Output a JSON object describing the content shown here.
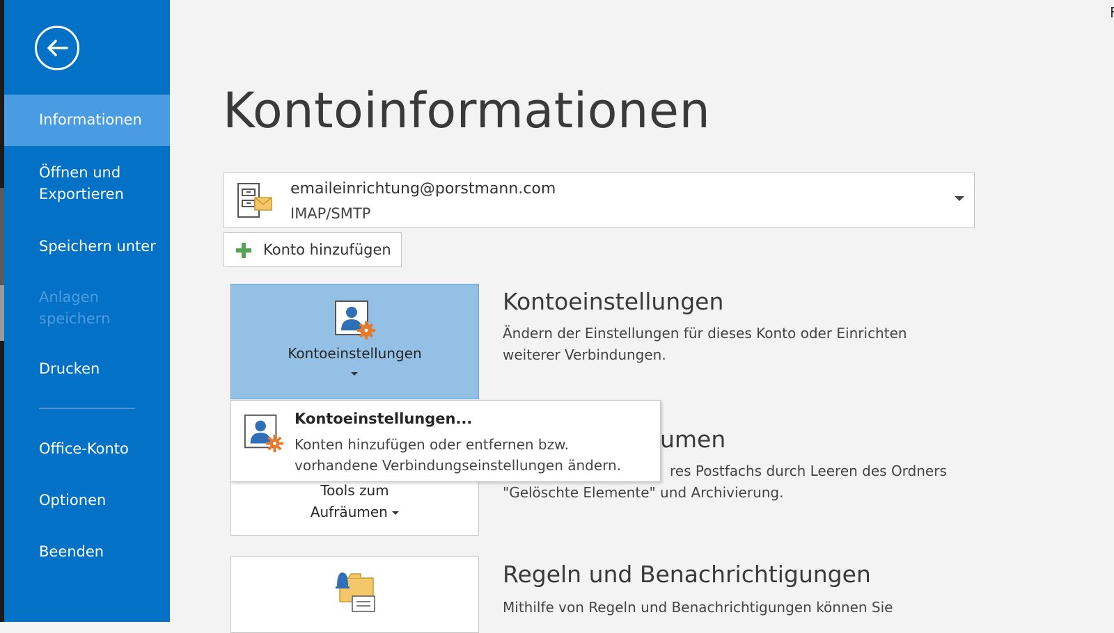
{
  "sidebar": {
    "items": [
      {
        "label": "Informationen"
      },
      {
        "label_line1": "Öffnen und",
        "label_line2": "Exportieren"
      },
      {
        "label": "Speichern unter"
      },
      {
        "label_line1": "Anlagen",
        "label_line2": "speichern"
      },
      {
        "label": "Drucken"
      },
      {
        "label": "Office-Konto"
      },
      {
        "label": "Optionen"
      },
      {
        "label": "Beenden"
      }
    ]
  },
  "main": {
    "title": "Kontoinformationen",
    "account": {
      "email": "emaileinrichtung@porstmann.com",
      "type": "IMAP/SMTP"
    },
    "add_account_label": "Konto hinzufügen",
    "sections": [
      {
        "tile_label": "Kontoeinstellungen",
        "title": "Kontoeinstellungen",
        "desc_line1": "Ändern der Einstellungen für dieses Konto oder Einrichten",
        "desc_line2": "weiterer Verbindungen."
      },
      {
        "tile_label_line1": "Tools zum",
        "tile_label_line2": "Aufräumen",
        "title_visible": "umen",
        "desc_line1_visible": "res Postfachs durch Leeren des Ordners",
        "desc_line2": "\"Gelöschte Elemente\" und Archivierung."
      },
      {
        "title": "Regeln und Benachrichtigungen",
        "desc_line1": "Mithilfe von Regeln und Benachrichtigungen können Sie"
      }
    ],
    "dropdown": {
      "title": "Kontoeinstellungen...",
      "desc_line1": "Konten hinzufügen oder entfernen bzw.",
      "desc_line2": "vorhandene Verbindungseinstellungen ändern."
    },
    "corner_char": "F"
  },
  "colors": {
    "sidebar_bg": "#0372c6",
    "sidebar_active": "#4a9ce2",
    "tile_selected": "#94c0e6",
    "page_bg": "#f3f3f3"
  },
  "icons": [
    "back-arrow-icon",
    "account-envelope-icon",
    "dropdown-caret-icon",
    "plus-icon",
    "account-settings-icon",
    "cleanup-tools-icon",
    "rules-alerts-icon"
  ]
}
